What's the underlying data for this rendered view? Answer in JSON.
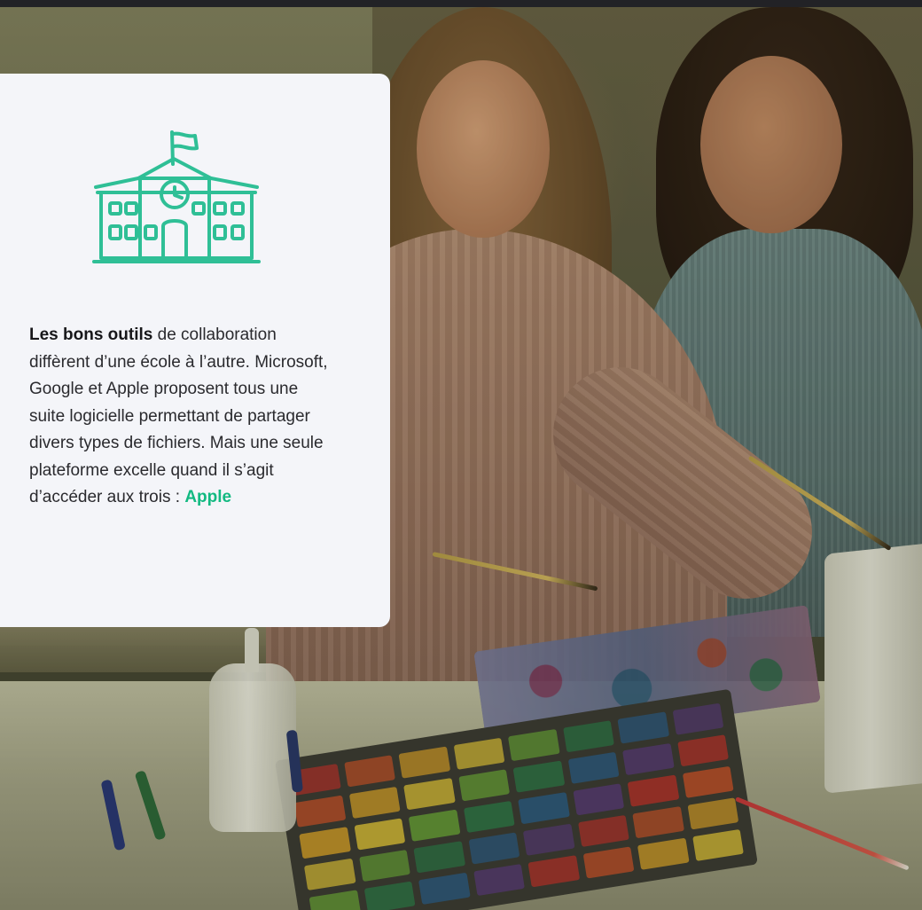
{
  "card": {
    "icon": "school-building-icon",
    "text_bold": "Les bons outils",
    "text_body": " de collaboration diffèrent d’une école à l’autre. Microsoft, Google et Apple proposent tous une suite logicielle permettant de partager divers types de fichiers. Mais une seule plateforme excelle quand il s’agit d’accéder aux trois : ",
    "text_highlight": "Apple"
  },
  "colors": {
    "accent": "#12b981",
    "icon_stroke": "#2fbf96",
    "card_bg": "#f4f5f9",
    "text": "#2a2a2e"
  },
  "photo": {
    "description_icon": "classroom-photo",
    "palette_colors": [
      "#b8342c",
      "#c8542a",
      "#d8a22a",
      "#e0c43a",
      "#6aa43a",
      "#2f7a4a",
      "#2d5f8a",
      "#5a3d7a"
    ]
  }
}
